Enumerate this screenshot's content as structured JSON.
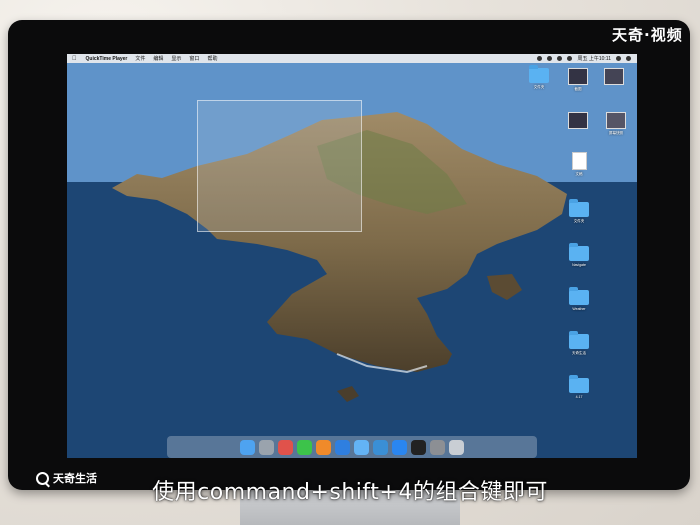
{
  "menubar": {
    "app_name": "QuickTime Player",
    "menus": [
      "文件",
      "编辑",
      "显示",
      "窗口",
      "帮助"
    ],
    "clock": "周五 上午10:11"
  },
  "desktop_icons": [
    {
      "kind": "folder",
      "label": "文件夹"
    },
    {
      "kind": "thumb",
      "label": "截图"
    },
    {
      "kind": "thumb",
      "label": ""
    },
    {
      "kind": "thumb",
      "label": ""
    },
    {
      "kind": "thumb",
      "label": "屏幕快照"
    },
    {
      "kind": "doc",
      "label": "文稿"
    },
    {
      "kind": "folder",
      "label": "文件夹"
    },
    {
      "kind": "folder",
      "label": "Navigate"
    },
    {
      "kind": "folder",
      "label": "Weather"
    },
    {
      "kind": "folder",
      "label": "天奇生活"
    },
    {
      "kind": "folder",
      "label": "4.17"
    }
  ],
  "dock_apps": [
    "finder",
    "launchpad",
    "safari",
    "wechat",
    "firefox",
    "chrome",
    "finder2",
    "xcode",
    "appstore",
    "terminal",
    "settings",
    "trash"
  ],
  "colors": {
    "folder": "#5ab2f2",
    "sea": "#1f4a78",
    "sky": "#6c9dd0"
  },
  "watermark_top": "天奇·视频",
  "watermark_bottom": "天奇生活",
  "subtitle": "使用command+shift+4的组合键即可"
}
